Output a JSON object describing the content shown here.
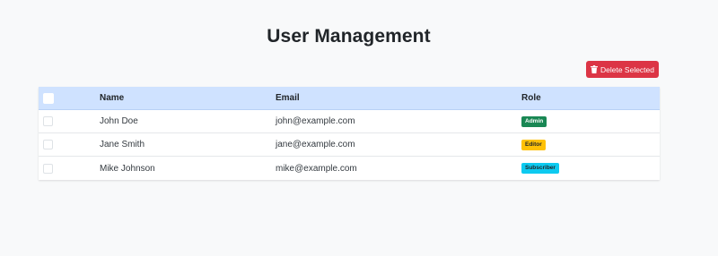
{
  "page": {
    "title": "User Management"
  },
  "toolbar": {
    "delete_label": "Delete Selected",
    "delete_icon": "trash-icon",
    "delete_color": "#dc3545"
  },
  "table": {
    "columns": [
      "",
      "Name",
      "Email",
      "Role"
    ],
    "header_color": "#cfe2ff",
    "rows": [
      {
        "name": "John Doe",
        "email": "john@example.com",
        "role": "Admin",
        "role_color": "#198754",
        "role_text_color": "#ffffff",
        "checked": false
      },
      {
        "name": "Jane Smith",
        "email": "jane@example.com",
        "role": "Editor",
        "role_color": "#ffc107",
        "role_text_color": "#212529",
        "checked": false
      },
      {
        "name": "Mike Johnson",
        "email": "mike@example.com",
        "role": "Subscriber",
        "role_color": "#0dcaf0",
        "role_text_color": "#212529",
        "checked": false
      }
    ]
  }
}
